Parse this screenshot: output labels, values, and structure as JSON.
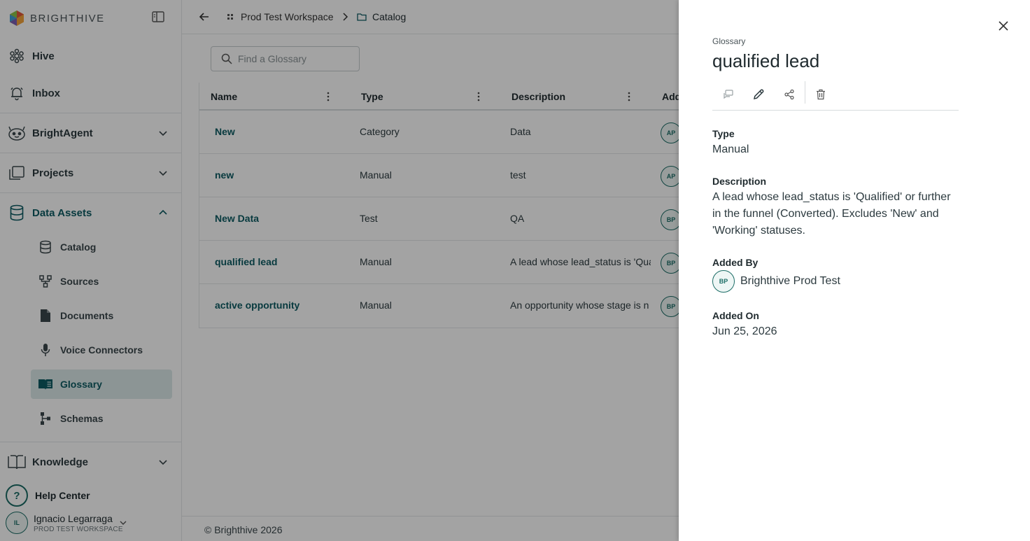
{
  "brand": {
    "name": "BRIGHTHIVE"
  },
  "sidebar": {
    "nav": [
      {
        "label": "Hive",
        "icon": "hive-icon"
      },
      {
        "label": "Inbox",
        "icon": "bell-icon"
      },
      {
        "label": "BrightAgent",
        "icon": "agent-icon"
      },
      {
        "label": "Projects",
        "icon": "projects-icon"
      },
      {
        "label": "Data Assets",
        "icon": "database-icon"
      },
      {
        "label": "Knowledge",
        "icon": "book-icon"
      }
    ],
    "data_assets_items": [
      {
        "label": "Catalog",
        "icon": "database-icon"
      },
      {
        "label": "Sources",
        "icon": "sources-icon"
      },
      {
        "label": "Documents",
        "icon": "document-icon"
      },
      {
        "label": "Voice Connectors",
        "icon": "microphone-icon"
      },
      {
        "label": "Glossary",
        "icon": "glossary-book-icon",
        "selected": true
      },
      {
        "label": "Schemas",
        "icon": "schema-icon"
      }
    ],
    "help": {
      "icon_text": "?",
      "label": "Help Center"
    },
    "user": {
      "initials": "IL",
      "name": "Ignacio Legarraga",
      "workspace": "PROD TEST WORKSPACE"
    }
  },
  "breadcrumb": {
    "workspace": "Prod Test Workspace",
    "current": "Catalog"
  },
  "search": {
    "placeholder": "Find a Glossary"
  },
  "table": {
    "columns": [
      "Name",
      "Type",
      "Description",
      "Add"
    ],
    "rows": [
      {
        "name": "New",
        "type": "Category",
        "description": "Data",
        "initials": "AP"
      },
      {
        "name": "new",
        "type": "Manual",
        "description": "test",
        "initials": "AP"
      },
      {
        "name": "New Data",
        "type": "Test",
        "description": "QA",
        "initials": "BP"
      },
      {
        "name": "qualified lead",
        "type": "Manual",
        "description": "A lead whose lead_status is 'Qua",
        "initials": "BP"
      },
      {
        "name": "active opportunity",
        "type": "Manual",
        "description": "An opportunity whose stage is n",
        "initials": "BP"
      }
    ]
  },
  "footer": {
    "text": "© Brighthive 2026"
  },
  "drawer": {
    "kicker": "Glossary",
    "title": "qualified lead",
    "type_label": "Type",
    "type_value": "Manual",
    "description_label": "Description",
    "description_value": "A lead whose lead_status is 'Qualified' or further in the funnel (Converted). Excludes 'New' and 'Working' statuses.",
    "added_by_label": "Added By",
    "added_by_initials": "BP",
    "added_by_name": "Brighthive Prod Test",
    "added_on_label": "Added On",
    "added_on_value": "Jun 25, 2026"
  },
  "colors": {
    "accent": "#0d5c63",
    "selected_bg": "#dceaea"
  }
}
